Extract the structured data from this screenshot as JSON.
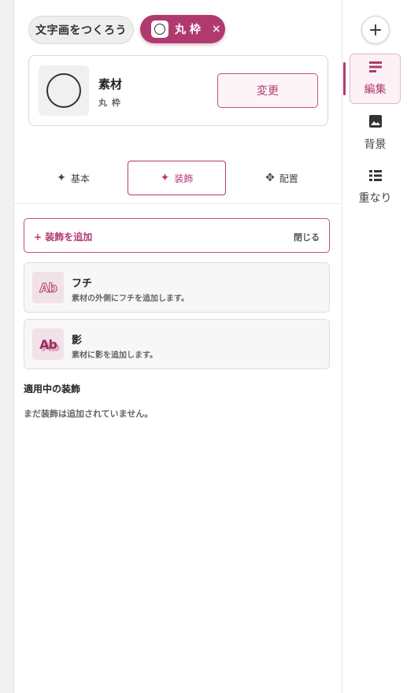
{
  "chips": {
    "text_label": "文字画をつくろう",
    "active_label": "丸 枠",
    "close_glyph": "×"
  },
  "material": {
    "title": "素材",
    "name": "丸 枠",
    "change_label": "変更"
  },
  "tabs": [
    {
      "label": "基本",
      "icon": "sparkle-icon"
    },
    {
      "label": "装飾",
      "icon": "sparkle-icon"
    },
    {
      "label": "配置",
      "icon": "move-icon"
    }
  ],
  "decoration": {
    "add_label": "+ 装飾を追加",
    "close_label": "閉じる",
    "options": [
      {
        "icon_text": "Ab",
        "title": "フチ",
        "description": "素材の外側にフチを追加します。"
      },
      {
        "icon_text": "Ab",
        "title": "影",
        "description": "素材に影を追加します。"
      }
    ],
    "applied_heading": "適用中の装飾",
    "empty_message": "まだ装飾は追加されていません。"
  },
  "rail": {
    "add_glyph": "+",
    "items": [
      {
        "label": "編集",
        "icon": "edit-text-icon"
      },
      {
        "label": "背景",
        "icon": "image-icon"
      },
      {
        "label": "重なり",
        "icon": "layers-list-icon"
      }
    ]
  },
  "colors": {
    "accent": "#b03a6e",
    "accent_light": "#fdf1f5",
    "panel_bg": "#f7f7f7"
  }
}
